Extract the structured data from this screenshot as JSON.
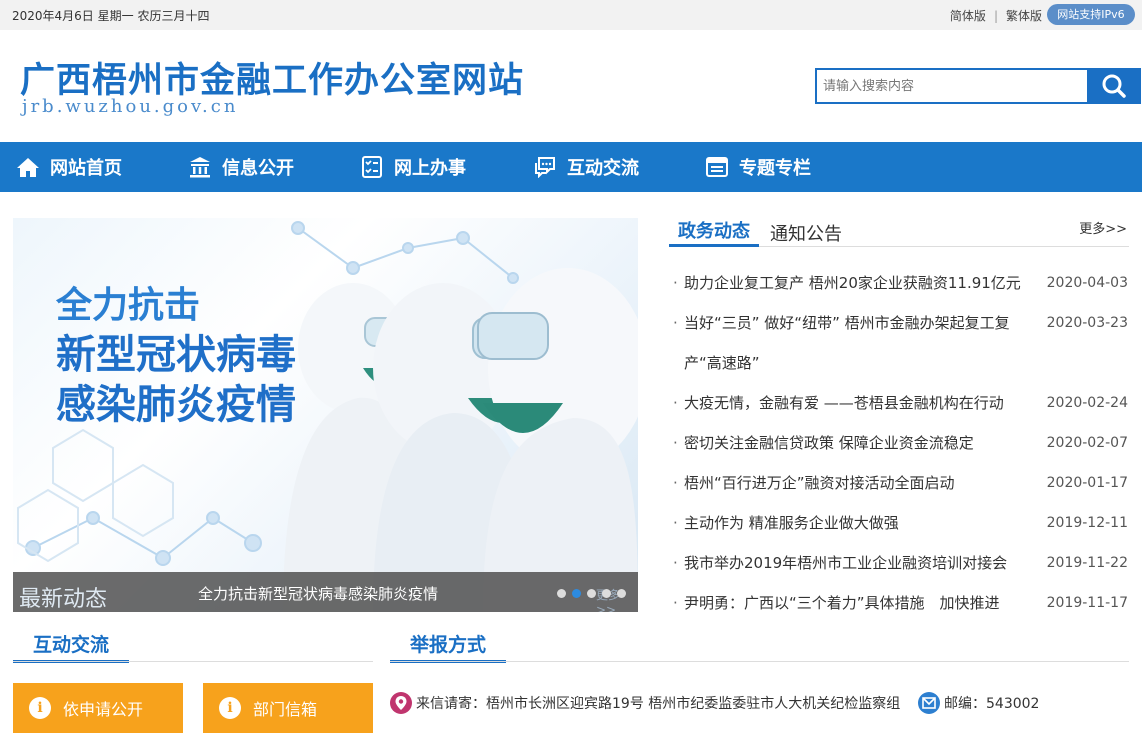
{
  "topbar": {
    "date": "2020年4月6日 星期一 农历三月十四",
    "simplified": "简体版",
    "separator": "|",
    "traditional": "繁体版",
    "ipv6": "网站支持IPv6"
  },
  "header": {
    "title": "广西梧州市金融工作办公室网站",
    "url": "jrb.wuzhou.gov.cn",
    "search_placeholder": "请输入搜索内容"
  },
  "nav": [
    {
      "label": "网站首页",
      "icon": "home-icon"
    },
    {
      "label": "信息公开",
      "icon": "building-icon"
    },
    {
      "label": "网上办事",
      "icon": "checklist-icon"
    },
    {
      "label": "互动交流",
      "icon": "chat-icon"
    },
    {
      "label": "专题专栏",
      "icon": "column-icon"
    }
  ],
  "slider": {
    "slogan_line1": "全力抗击",
    "slogan_line2": "新型冠状病毒",
    "slogan_line3": "感染肺炎疫情",
    "tag": "最新动态",
    "caption": "全力抗击新型冠状病毒感染肺炎疫情",
    "ghost_more": "更多>>",
    "dots": 5,
    "active_dot": 2
  },
  "news": {
    "tab_active": "政务动态",
    "tab_other": "通知公告",
    "more": "更多>>",
    "bullet": "·",
    "items": [
      {
        "title": "助力企业复工复产 梧州20家企业获融资11.91亿元",
        "date": "2020-04-03"
      },
      {
        "title": "当好“三员” 做好“纽带” 梧州市金融办架起复工复产“高速路”",
        "date": "2020-03-23"
      },
      {
        "title": "大疫无情，金融有爱 ——苍梧县金融机构在行动",
        "date": "2020-02-24"
      },
      {
        "title": "密切关注金融信贷政策 保障企业资金流稳定",
        "date": "2020-02-07"
      },
      {
        "title": "梧州“百行进万企”融资对接活动全面启动",
        "date": "2020-01-17"
      },
      {
        "title": "主动作为 精准服务企业做大做强",
        "date": "2019-12-11"
      },
      {
        "title": "我市举办2019年梧州市工业企业融资培训对接会",
        "date": "2019-11-22"
      },
      {
        "title": "尹明勇：广西以“三个着力”具体措施　加快推进",
        "date": "2019-11-17"
      }
    ]
  },
  "interact": {
    "heading": "互动交流",
    "btn1": "依申请公开",
    "btn2": "部门信箱",
    "btn_icon": "i"
  },
  "report": {
    "heading": "举报方式",
    "address": "来信请寄：梧州市长洲区迎宾路19号 梧州市纪委监委驻市人大机关纪检监察组",
    "postcode": "邮编：543002"
  },
  "colors": {
    "brand_blue": "#1a78c9",
    "orange": "#f7a21c"
  }
}
